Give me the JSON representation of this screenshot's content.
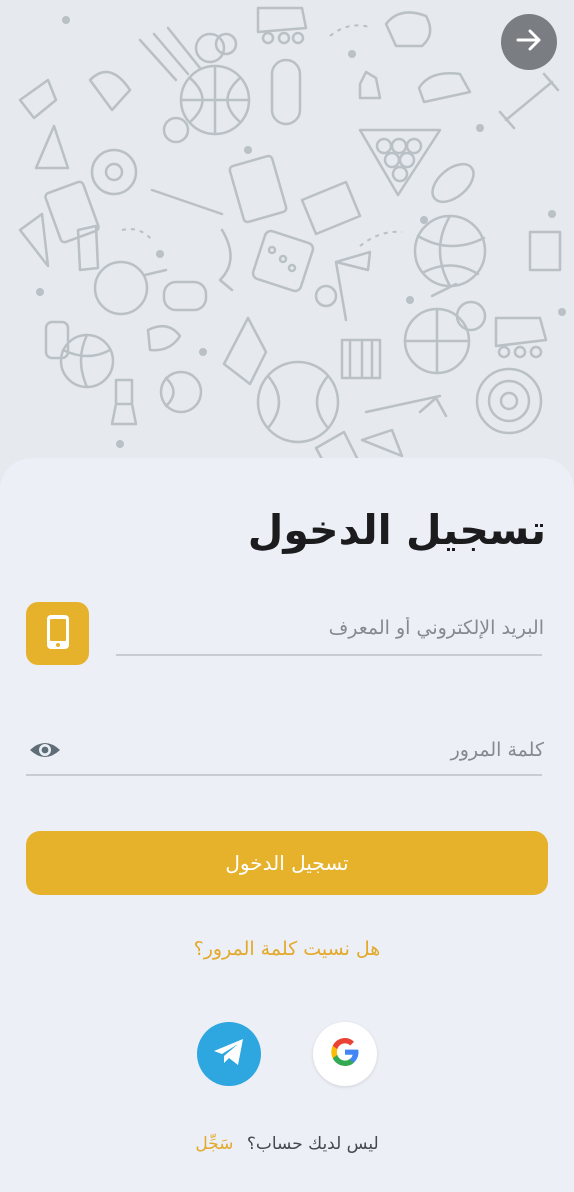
{
  "header": {
    "back_icon": "arrow-right-icon",
    "background_pattern": "sports-doodle-pattern"
  },
  "form": {
    "title": "تسجيل الدخول",
    "email_placeholder": "البريد الإلكتروني أو المعرف",
    "email_value": "",
    "phone_icon": "smartphone-icon",
    "password_placeholder": "كلمة المرور",
    "password_value": "",
    "eye_icon": "eye-icon",
    "login_label": "تسجيل الدخول",
    "forgot_label": "هل نسيت كلمة المرور؟"
  },
  "social": {
    "telegram_icon": "telegram-icon",
    "google_icon": "google-icon"
  },
  "signup": {
    "question": "ليس لديك حساب؟",
    "link_label": "سَجِّل"
  },
  "colors": {
    "accent": "#e6b22c",
    "link": "#e3a92a",
    "telegram": "#2ea6e0",
    "sheet": "#eceff5"
  }
}
